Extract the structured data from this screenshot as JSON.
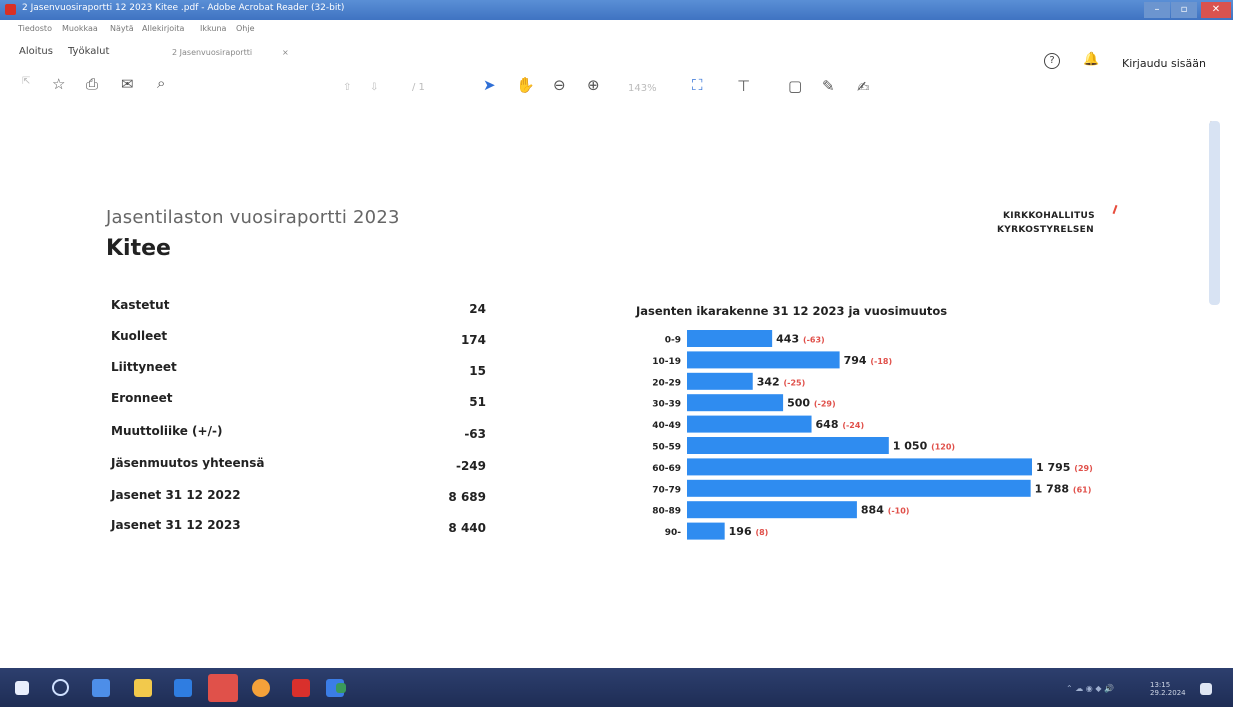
{
  "window": {
    "title": "2 Jasenvuosiraportti 12 2023 Kitee .pdf - Adobe Acrobat Reader (32-bit)",
    "controls": {
      "minimize": "–",
      "maximize": "▫",
      "close": "✕"
    }
  },
  "menu": [
    "Tiedosto",
    "Muokkaa",
    "Näytä",
    "Allekirjoita",
    "Ikkuna",
    "Ohje"
  ],
  "tabs": {
    "home": "Aloitus",
    "tools": "Työkalut",
    "document": "2 Jasenvuosiraportti",
    "doc_close": "×"
  },
  "header_right": {
    "signin": "Kirjaudu sisään",
    "help": "?"
  },
  "toolbar": {
    "page_text": "/ 1",
    "zoom_text": "143%",
    "icons": [
      "star-icon",
      "print-icon",
      "mail-icon",
      "search-icon",
      "select-icon",
      "hand-icon",
      "zoom-out-icon",
      "zoom-in-icon",
      "fit-icon",
      "comment-icon",
      "pen-icon",
      "sign-icon"
    ]
  },
  "document": {
    "subtitle": "Jasentilaston vuosiraportti 2023",
    "title": "Kitee",
    "logo_line1": "KIRKKOHALLITUS",
    "logo_line2": "KYRKOSTYRELSEN",
    "stats": [
      {
        "label": "Kastetut",
        "value": "24"
      },
      {
        "label": "Kuolleet",
        "value": "174"
      },
      {
        "label": "Liittyneet",
        "value": "15"
      },
      {
        "label": "Eronneet",
        "value": "51"
      },
      {
        "label": "Muuttoliike (+/-)",
        "value": "-63"
      },
      {
        "label": "Jäsenmuutos yhteensä",
        "value": "-249"
      },
      {
        "label": "Jasenet 31 12 2022",
        "value": "8 689"
      },
      {
        "label": "Jasenet 31 12 2023",
        "value": "8 440"
      }
    ]
  },
  "chart_data": {
    "type": "bar",
    "orientation": "horizontal",
    "title": "Jasenten ikarakenne 31 12 2023 ja vuosimuutos",
    "categories": [
      "0-9",
      "10-19",
      "20-29",
      "30-39",
      "40-49",
      "50-59",
      "60-69",
      "70-79",
      "80-89",
      "90-"
    ],
    "values": [
      443,
      794,
      342,
      500,
      648,
      1050,
      1795,
      1788,
      884,
      196
    ],
    "value_labels": [
      "443",
      "794",
      "342",
      "500",
      "648",
      "1 050",
      "1 795",
      "1 788",
      "884",
      "196"
    ],
    "changes": [
      "(-63)",
      "(-18)",
      "(-25)",
      "(-29)",
      "(-24)",
      "(120)",
      "(29)",
      "(61)",
      "(-10)",
      "(8)"
    ],
    "bar_color": "#2f8cf0",
    "xlim": [
      0,
      1795
    ]
  },
  "taskbar": {
    "time": "13:15",
    "date": "29.2.2024"
  }
}
